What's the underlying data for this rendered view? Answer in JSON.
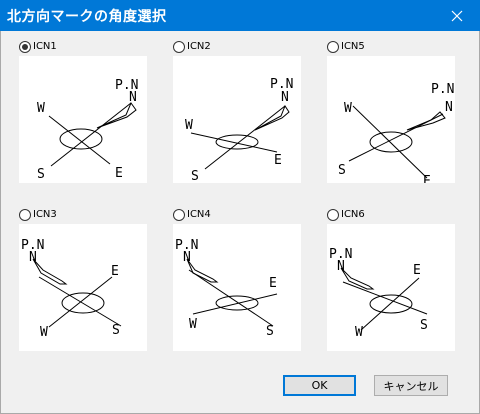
{
  "window": {
    "title": "北方向マークの角度選択"
  },
  "options": [
    {
      "label": "ICN1",
      "checked": true,
      "north_label": "P.N",
      "north_letter": "N",
      "w": "W",
      "e": "E",
      "s": "S"
    },
    {
      "label": "ICN2",
      "checked": false,
      "north_label": "P.N",
      "north_letter": "N",
      "w": "W",
      "e": "E",
      "s": "S"
    },
    {
      "label": "ICN5",
      "checked": false,
      "north_label": "P.N",
      "north_letter": "N",
      "w": "W",
      "e": "E",
      "s": "S"
    },
    {
      "label": "ICN3",
      "checked": false,
      "north_label": "P.N",
      "north_letter": "N",
      "w": "W",
      "e": "E",
      "s": "S"
    },
    {
      "label": "ICN4",
      "checked": false,
      "north_label": "P.N",
      "north_letter": "N",
      "w": "W",
      "e": "E",
      "s": "S"
    },
    {
      "label": "ICN6",
      "checked": false,
      "north_label": "P.N",
      "north_letter": "N",
      "w": "W",
      "e": "E",
      "s": "S"
    }
  ],
  "buttons": {
    "ok": "OK",
    "cancel": "キャンセル"
  },
  "colors": {
    "titlebar": "#0078d7",
    "dialog_bg": "#f0f0f0",
    "preview_bg": "#ffffff"
  },
  "icons": {
    "close": "close-icon",
    "compass": "north-arrow-icon"
  }
}
